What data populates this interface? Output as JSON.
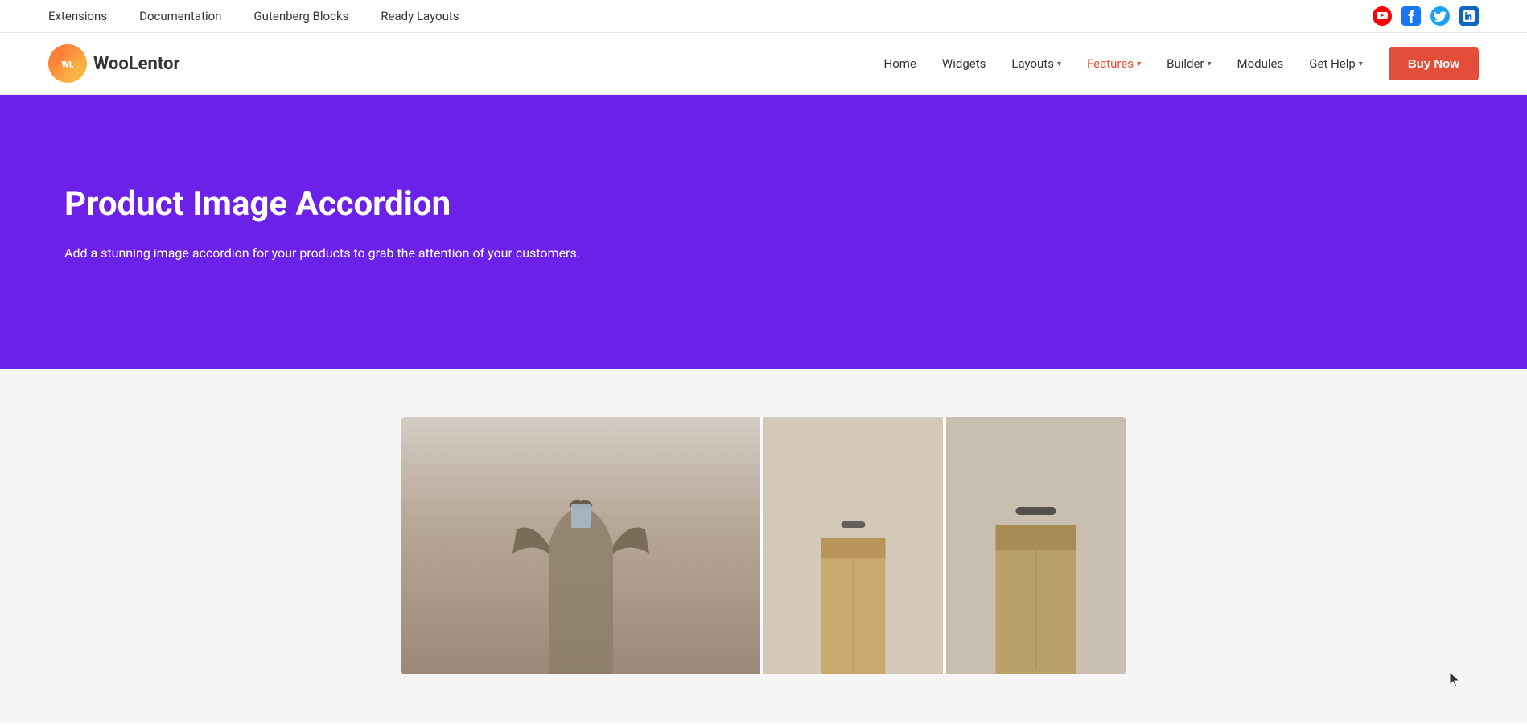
{
  "topbar": {
    "nav_items": [
      {
        "label": "Extensions",
        "href": "#"
      },
      {
        "label": "Documentation",
        "href": "#"
      },
      {
        "label": "Gutenberg Blocks",
        "href": "#"
      },
      {
        "label": "Ready Layouts",
        "href": "#"
      }
    ],
    "social_icons": [
      {
        "name": "youtube",
        "label": "YouTube",
        "icon": "▶"
      },
      {
        "name": "facebook",
        "label": "Facebook",
        "icon": "f"
      },
      {
        "name": "twitter",
        "label": "Twitter",
        "icon": "t"
      },
      {
        "name": "linkedin",
        "label": "LinkedIn",
        "icon": "in"
      }
    ]
  },
  "mainnav": {
    "logo_initials": "WL",
    "logo_brand_first": "Woo",
    "logo_brand_second": "Lentor",
    "nav_items": [
      {
        "label": "Home",
        "has_dropdown": false,
        "active": false
      },
      {
        "label": "Widgets",
        "has_dropdown": false,
        "active": false
      },
      {
        "label": "Layouts",
        "has_dropdown": true,
        "active": false
      },
      {
        "label": "Features",
        "has_dropdown": true,
        "active": true
      },
      {
        "label": "Builder",
        "has_dropdown": true,
        "active": false
      },
      {
        "label": "Modules",
        "has_dropdown": false,
        "active": false
      },
      {
        "label": "Get Help",
        "has_dropdown": true,
        "active": false
      }
    ],
    "buy_button_label": "Buy Now"
  },
  "hero": {
    "title": "Product Image Accordion",
    "description": "Add a stunning image accordion for your products to grab the attention of your customers.",
    "background_color": "#6B21E8"
  },
  "content": {
    "background_color": "#f5f5f5"
  },
  "colors": {
    "accent_red": "#e44d3a",
    "hero_purple": "#6B21E8",
    "nav_active": "#e44d3a"
  }
}
